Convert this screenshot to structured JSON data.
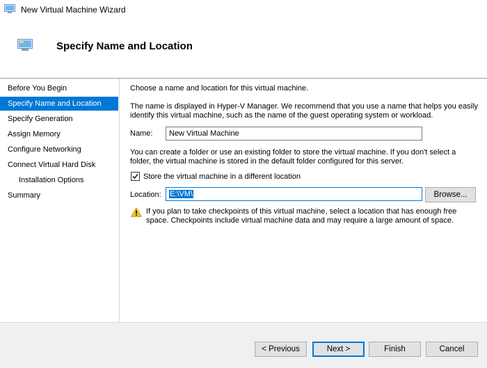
{
  "window": {
    "title": "New Virtual Machine Wizard"
  },
  "header": {
    "title": "Specify Name and Location"
  },
  "nav": {
    "items": [
      {
        "label": "Before You Begin"
      },
      {
        "label": "Specify Name and Location"
      },
      {
        "label": "Specify Generation"
      },
      {
        "label": "Assign Memory"
      },
      {
        "label": "Configure Networking"
      },
      {
        "label": "Connect Virtual Hard Disk"
      },
      {
        "label": "Installation Options"
      },
      {
        "label": "Summary"
      }
    ],
    "selected_index": 1
  },
  "content": {
    "intro": "Choose a name and location for this virtual machine.",
    "desc_line1": "The name is displayed in Hyper-V Manager. We recommend that you use a name that helps you easily",
    "desc_line2": "identify this virtual machine, such as the name of the guest operating system or workload.",
    "name_label": "Name:",
    "name_value": "New Virtual Machine",
    "folder_line1": "You can create a folder or use an existing folder to store the virtual machine. If you don't select a",
    "folder_line2": "folder, the virtual machine is stored in the default folder configured for this server.",
    "store_checkbox_label": "Store the virtual machine in a different location",
    "store_checked": true,
    "location_label": "Location:",
    "location_value": "E:\\VM\\",
    "browse_label": "Browse...",
    "warning_line1": "If you plan to take checkpoints of this virtual machine, select a location that has enough free",
    "warning_line2": "space. Checkpoints include virtual machine data and may require a large amount of space."
  },
  "footer": {
    "previous_label": "< Previous",
    "next_label": "Next >",
    "finish_label": "Finish",
    "cancel_label": "Cancel"
  },
  "colors": {
    "accent": "#0078d7",
    "warning": "#f5c518"
  },
  "icons": {
    "window": "vm-window-icon",
    "header": "vm-header-icon",
    "warning": "warning-icon"
  }
}
